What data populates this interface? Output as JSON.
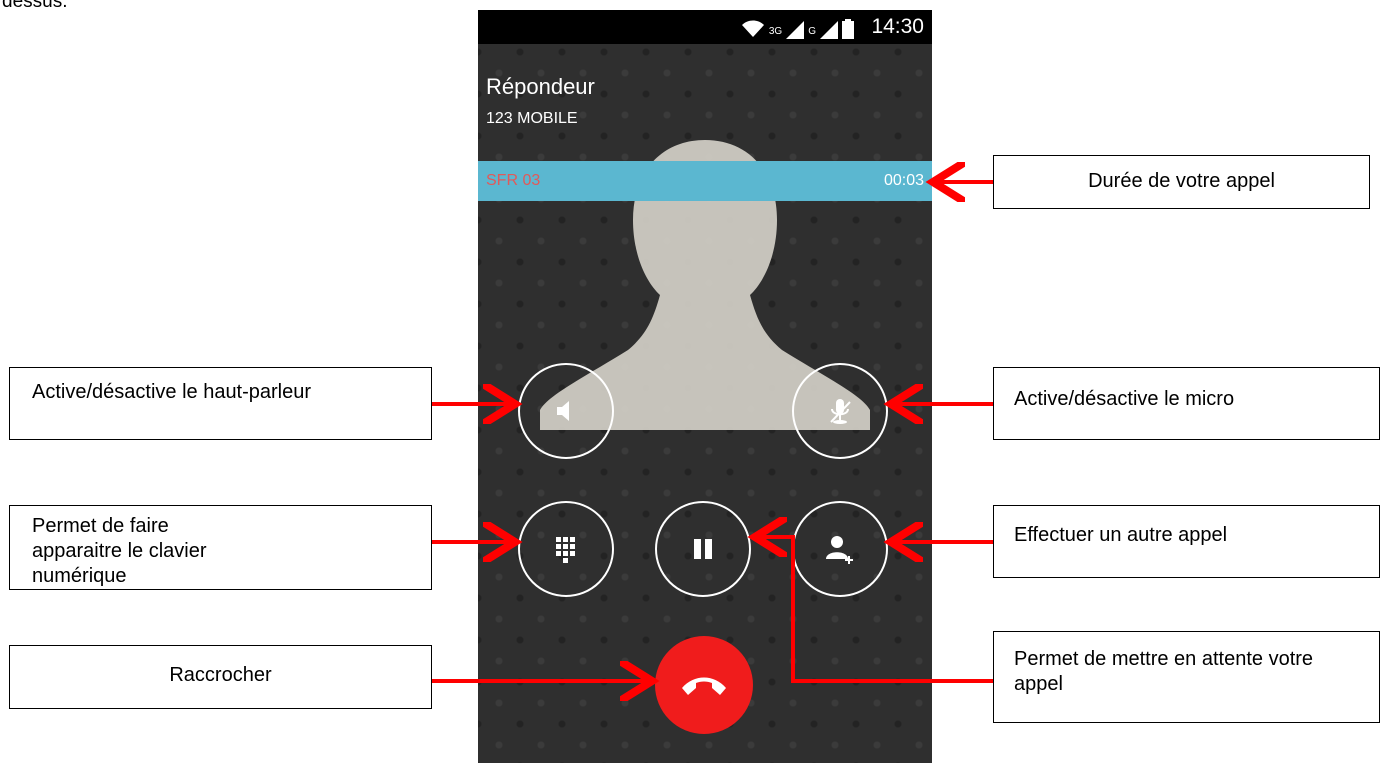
{
  "snippet": "dessus.",
  "status": {
    "time": "14:30",
    "net1": "3G",
    "net2": "G"
  },
  "caller": {
    "name": "Répondeur",
    "number": "123 MOBILE"
  },
  "callbar": {
    "operator": "SFR 03",
    "duration": "00:03"
  },
  "icons": {
    "speaker": "speaker-icon",
    "mic": "mic-muted-icon",
    "dialpad": "dialpad-icon",
    "hold": "pause-icon",
    "add_call": "add-contact-icon",
    "hangup": "phone-hangup-icon"
  },
  "colors": {
    "callbar": "#5bb7d0",
    "hangup": "#f01c1c",
    "arrow": "#ff0000",
    "operator": "#e05a5a"
  },
  "annotations": {
    "duration": "Durée de votre appel",
    "speaker": "Active/désactive le haut-parleur",
    "mic": "Active/désactive le micro",
    "dialpad": "Permet de faire apparaitre le clavier numérique",
    "add_call": "Effectuer un autre appel",
    "hangup": "Raccrocher",
    "hold": "Permet de mettre en attente votre appel"
  }
}
